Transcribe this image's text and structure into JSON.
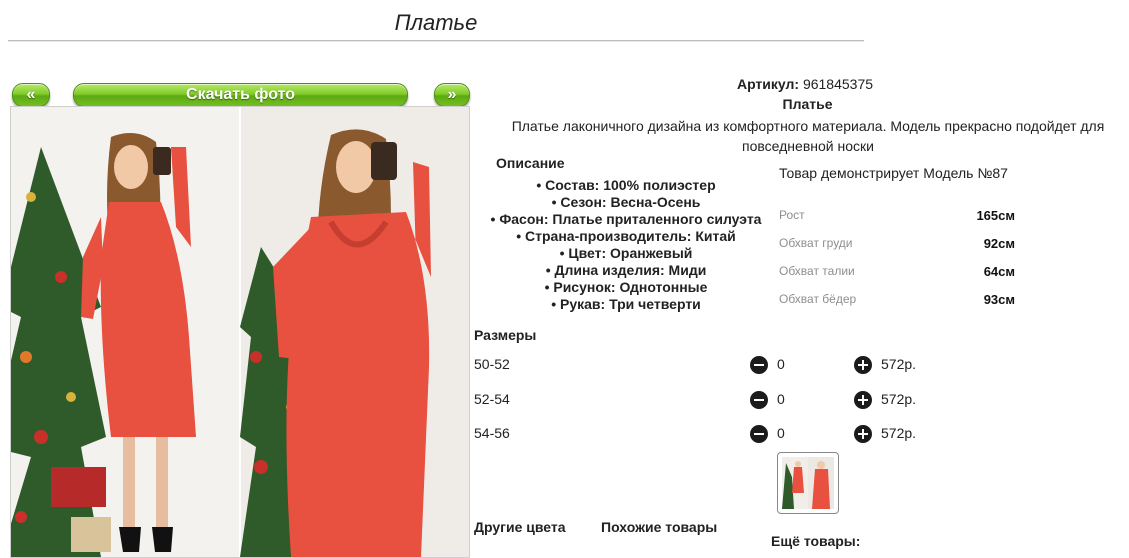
{
  "page": {
    "title": "Платье"
  },
  "gallery": {
    "prev_label": "«",
    "next_label": "»",
    "download_label": "Скачать фото"
  },
  "product": {
    "article_label": "Артикул:",
    "article_value": "961845375",
    "name": "Платье",
    "description": "Платье лаконичного дизайна из комфортного материала. Модель прекрасно подойдет для повседневной носки"
  },
  "details": {
    "heading": "Описание",
    "items": [
      "Состав: 100% полиэстер",
      "Сезон: Весна-Осень",
      "Фасон: Платье приталенного силуэта",
      "Страна-производитель: Китай",
      "Цвет: Оранжевый",
      "Длина изделия: Миди",
      "Рисунок: Однотонные",
      "Рукав: Три четверти"
    ]
  },
  "model": {
    "demo_text": "Товар демонстрирует Модель №87",
    "measurements": [
      {
        "label": "Рост",
        "value": "165см"
      },
      {
        "label": "Обхват груди",
        "value": "92см"
      },
      {
        "label": "Обхват талии",
        "value": "64см"
      },
      {
        "label": "Обхват бёдер",
        "value": "93см"
      }
    ]
  },
  "sizes": {
    "heading": "Размеры",
    "rows": [
      {
        "size": "50-52",
        "qty": "0",
        "price": "572р."
      },
      {
        "size": "52-54",
        "qty": "0",
        "price": "572р."
      },
      {
        "size": "54-56",
        "qty": "0",
        "price": "572р."
      }
    ]
  },
  "sections": {
    "other_colors": "Другие цвета",
    "similar": "Похожие товары",
    "more_goods": "Ещё товары:"
  },
  "colors": {
    "button_green": "#6fbb1f",
    "dress_coral": "#e8503f"
  }
}
